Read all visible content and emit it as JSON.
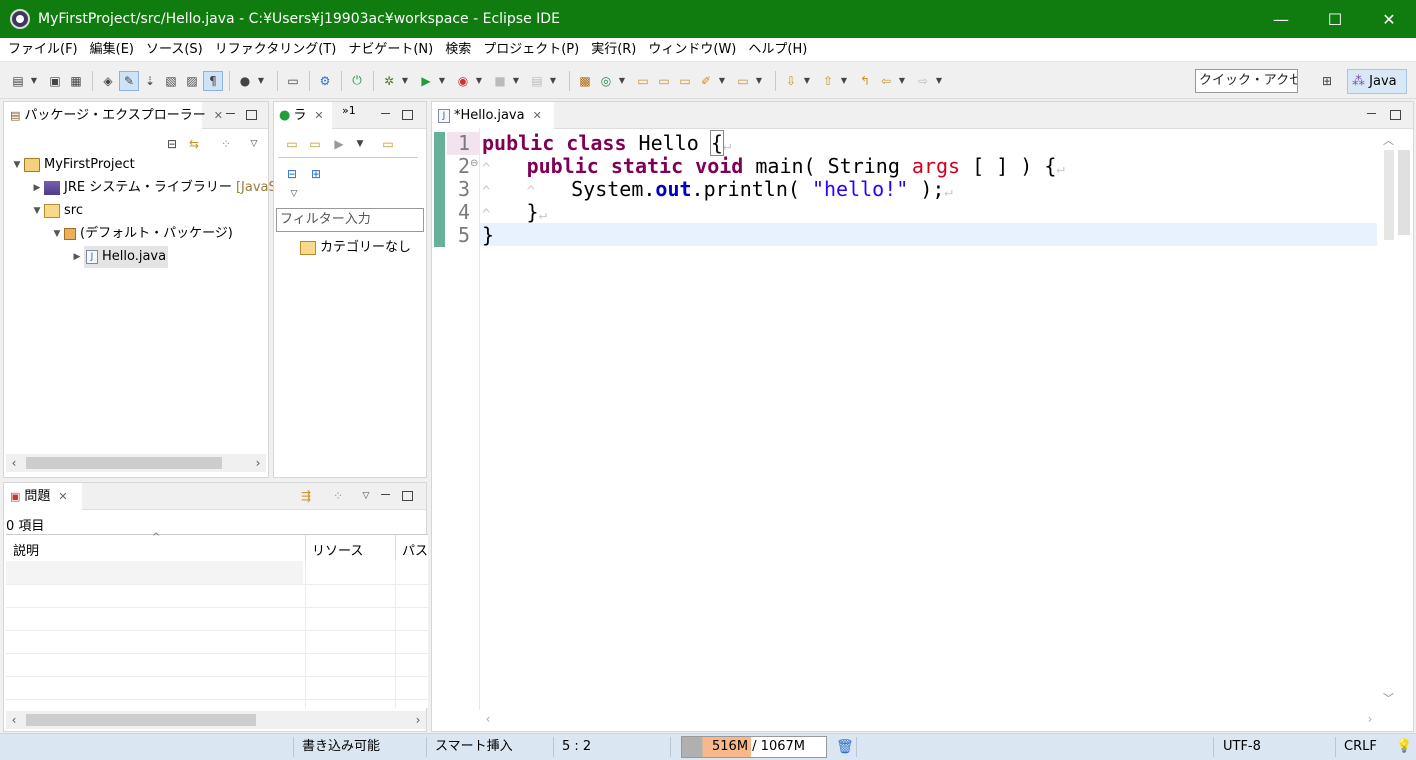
{
  "window": {
    "title": "MyFirstProject/src/Hello.java - C:¥Users¥j19903ac¥workspace - Eclipse IDE",
    "minimize": "—",
    "maximize": "☐",
    "close": "✕"
  },
  "menu": [
    "ファイル(F)",
    "編集(E)",
    "ソース(S)",
    "リファクタリング(T)",
    "ナビゲート(N)",
    "検索",
    "プロジェクト(P)",
    "実行(R)",
    "ウィンドウ(W)",
    "ヘルプ(H)"
  ],
  "toolbar": {
    "quick_access": "クイック・アクセス",
    "perspective": "Java"
  },
  "package_explorer": {
    "tab_label": "パッケージ・エクスプローラー",
    "tree": [
      {
        "label": "MyFirstProject"
      },
      {
        "label": "JRE システム・ライブラリー",
        "suffix": "[JavaSE"
      },
      {
        "label": "src"
      },
      {
        "label": "(デフォルト・パッケージ)"
      },
      {
        "label": "Hello.java"
      }
    ]
  },
  "second_panel": {
    "tab_label": "ラ",
    "overflow": "»1",
    "filter_placeholder": "フィルター入力",
    "category": "カテゴリーなし"
  },
  "editor": {
    "tab_label": "*Hello.java",
    "line_numbers": [
      "1",
      "2",
      "3",
      "4",
      "5"
    ],
    "fold_marker": "⊖"
  },
  "problems": {
    "tab_label": "問題",
    "count": "0 項目",
    "columns": [
      "説明",
      "リソース",
      "パス"
    ]
  },
  "status": {
    "writable": "書き込み可能",
    "insert_mode": "スマート挿入",
    "position": "5 : 2",
    "heap": "516M / 1067M",
    "heap_used_fraction": 0.48,
    "encoding": "UTF-8",
    "line_delimiter": "CRLF"
  }
}
